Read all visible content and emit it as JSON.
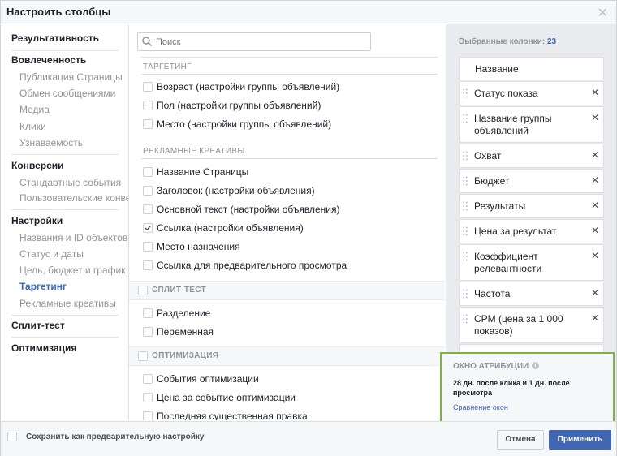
{
  "dialog": {
    "title": "Настроить столбцы"
  },
  "sidebar": {
    "categories": [
      {
        "label": "Результативность",
        "subs": []
      },
      {
        "label": "Вовлеченность",
        "subs": [
          "Публикация Страницы",
          "Обмен сообщениями",
          "Медиа",
          "Клики",
          "Узнаваемость"
        ]
      },
      {
        "label": "Конверсии",
        "subs": [
          "Стандартные события",
          "Пользовательские конверсии"
        ]
      },
      {
        "label": "Настройки",
        "subs": [
          "Названия и ID объектов",
          "Статус и даты",
          "Цель, бюджет и график",
          "Таргетинг",
          "Рекламные креативы"
        ]
      },
      {
        "label": "Сплит-тест",
        "subs": []
      },
      {
        "label": "Оптимизация",
        "subs": []
      }
    ],
    "active_sub": "Таргетинг"
  },
  "search": {
    "placeholder": "Поиск"
  },
  "middle": {
    "targeting_label": "ТАРГЕТИНГ",
    "targeting_items": [
      "Возраст (настройки группы объявлений)",
      "Пол (настройки группы объявлений)",
      "Место (настройки группы объявлений)"
    ],
    "creatives_label": "РЕКЛАМНЫЕ КРЕАТИВЫ",
    "creatives_items": [
      {
        "label": "Название Страницы",
        "checked": false
      },
      {
        "label": "Заголовок (настройки объявления)",
        "checked": false
      },
      {
        "label": "Основной текст (настройки объявления)",
        "checked": false
      },
      {
        "label": "Ссылка (настройки объявления)",
        "checked": true
      },
      {
        "label": "Место назначения",
        "checked": false
      },
      {
        "label": "Ссылка для предварительного просмотра",
        "checked": false
      }
    ],
    "split_label": "СПЛИТ-ТЕСТ",
    "split_items": [
      "Разделение",
      "Переменная"
    ],
    "opt_label": "ОПТИМИЗАЦИЯ",
    "opt_items": [
      "События оптимизации",
      "Цена за событие оптимизации",
      "Последняя существенная правка"
    ]
  },
  "selected": {
    "label": "Выбранные колонки:",
    "count": "23",
    "columns": [
      "Название",
      "Статус показа",
      "Название группы объявлений",
      "Охват",
      "Бюджет",
      "Результаты",
      "Цена за результат",
      "Коэффициент релевантности",
      "Частота",
      "CPM (цена за 1 000 показов)"
    ]
  },
  "attribution": {
    "title": "ОКНО АТРИБУЦИИ",
    "description": "28 дн. после клика и 1 дн. после просмотра",
    "link": "Сравнение окон"
  },
  "footer": {
    "save_preset": "Сохранить как предварительную настройку",
    "cancel": "Отмена",
    "apply": "Применить"
  }
}
